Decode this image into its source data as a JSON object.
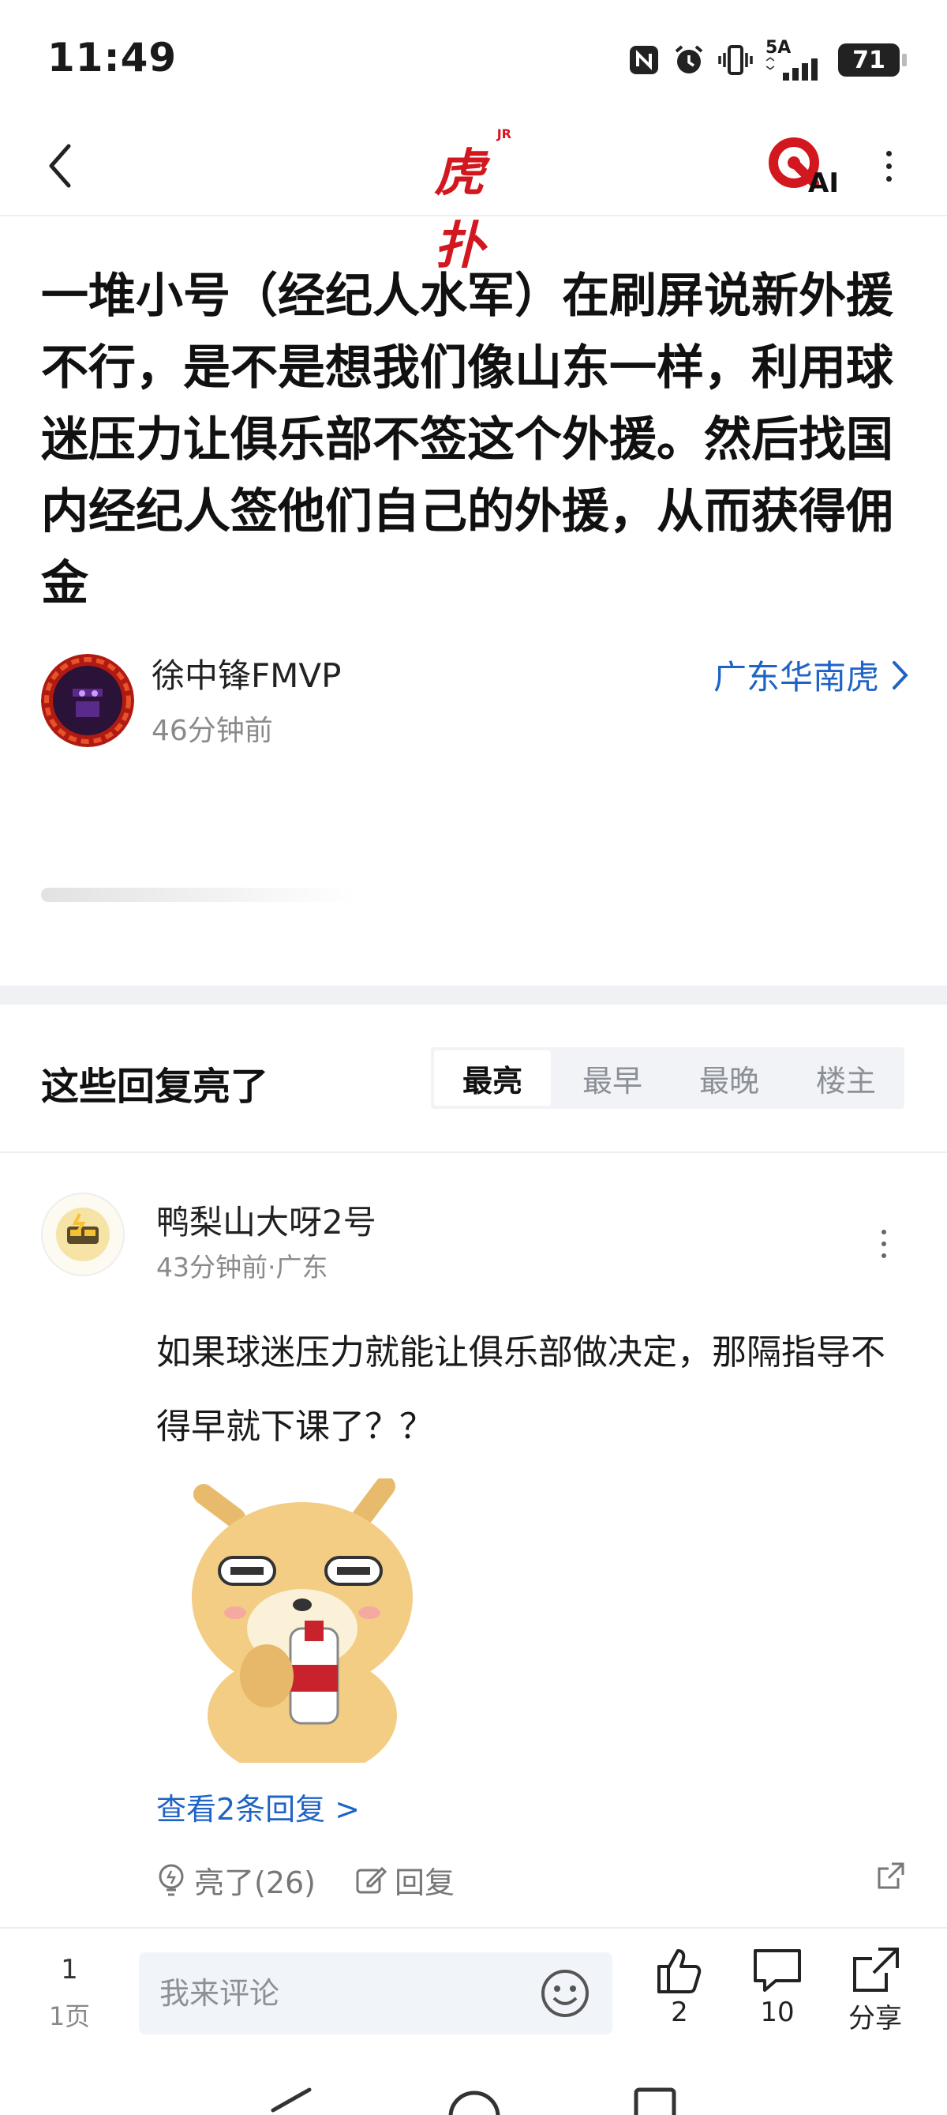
{
  "status_bar": {
    "time": "11:49",
    "network": "5A",
    "battery": "71"
  },
  "nav": {
    "logo_text": "虎扑",
    "logo_jr": "JR",
    "ai_label": "AI"
  },
  "post": {
    "title": "一堆小号（经纪人水军）在刷屏说新外援不行，是不是想我们像山东一样，利用球迷压力让俱乐部不签这个外援。然后找国内经纪人签他们自己的外援，从而获得佣金",
    "author": "徐中锋FMVP",
    "time": "46分钟前",
    "topic": "广东华南虎"
  },
  "replies": {
    "title": "这些回复亮了",
    "tabs": [
      "最亮",
      "最早",
      "最晚",
      "楼主"
    ],
    "active_tab": "最亮"
  },
  "comment": {
    "username": "鸭梨山大呀2号",
    "meta": "43分钟前·广东",
    "text": "如果球迷压力就能让俱乐部做决定，那隔指导不得早就下课了？？",
    "view_replies": "查看2条回复 >",
    "like_label": "亮了(26)",
    "reply_label": "回复"
  },
  "bottom_bar": {
    "page_current": "1",
    "page_total": "1页",
    "input_placeholder": "我来评论",
    "likes": "2",
    "comments": "10",
    "share": "分享"
  },
  "colors": {
    "brand_red": "#d3171f",
    "link_blue": "#1f63c6"
  }
}
